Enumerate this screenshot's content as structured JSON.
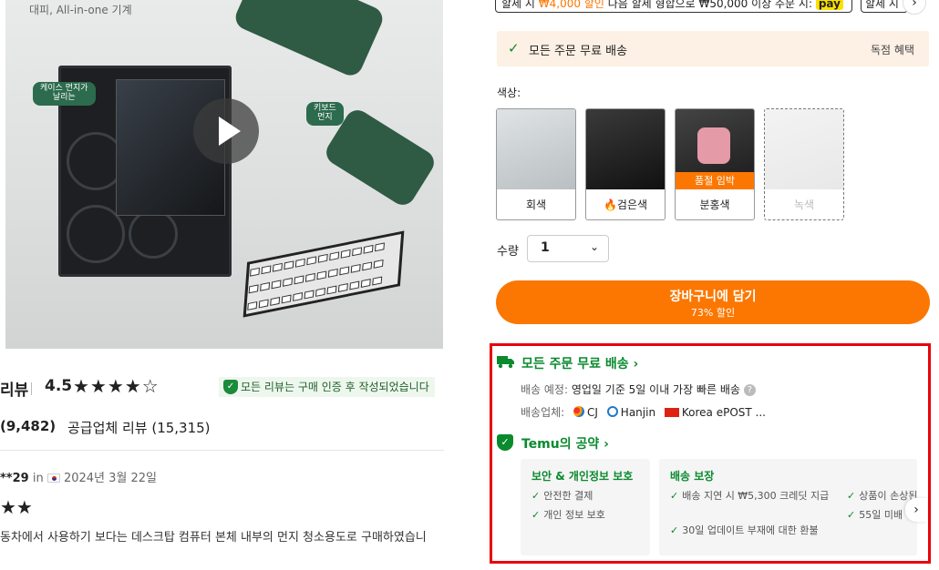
{
  "hero": {
    "caption": "대피, All-in-one 기계",
    "tag_case": "케이스 먼지가\n날리는",
    "tag_keyboard": "키보드\n먼지"
  },
  "reviews": {
    "title": "리뷰",
    "score": "4.5",
    "stars": "★★★★☆",
    "rating": 4.5,
    "verified_text": "모든 리뷰는 구매 인증 후 작성되었습니다",
    "count_product": "(9,482)",
    "count_supplier": "공급업체 리뷰 (15,315)",
    "first": {
      "user": "**29",
      "in": "in",
      "date": "2024년 3월 22일",
      "stars": "★★",
      "text": "동차에서 사용하기 보다는 데스크탑 컴퓨터 본체 내부의 먼지 청소용도로 구매하였습니"
    }
  },
  "promo": {
    "left_text_a": "할세 시 ",
    "left_price": "₩4,000 할인",
    "left_text_b": " 다음 할세 형합으로 ₩50,000 이상 주문 시: ",
    "pay": "pay",
    "right_text": "할세 시"
  },
  "free_shipping_banner": {
    "text": "모든 주문 무료 배송",
    "right": "독점 혜택"
  },
  "color": {
    "label": "색상:",
    "options": [
      {
        "label": "회색",
        "badge": ""
      },
      {
        "label": "검은색",
        "badge": ""
      },
      {
        "label": "분홍색",
        "badge": "품절 임박"
      },
      {
        "label": "녹색",
        "badge": ""
      }
    ]
  },
  "quantity": {
    "label": "수량",
    "value": "1"
  },
  "cart": {
    "label": "장바구니에 담기",
    "discount": "73% 할인"
  },
  "shipping": {
    "title": "모든 주문 무료 배송 ›",
    "eta_label": "배송 예정: ",
    "eta_value": "영업일 기준 5일 이내 가장 빠른 배송",
    "carriers_label": "배송업체:",
    "carriers": [
      "CJ",
      "Hanjin",
      "Korea ePOST ..."
    ]
  },
  "promise": {
    "title": "Temu의 공약 ›",
    "cards": [
      {
        "title": "보안 & 개인정보 보호",
        "items": [
          "안전한 결제",
          "개인 정보 보호"
        ]
      },
      {
        "title": "배송 보장",
        "items": [
          "배송 지연 시 ₩5,300 크레딧 지급",
          "30일 업데이트 부재에 대한 환불",
          "상품이 손상된",
          "55일 미배"
        ]
      }
    ]
  },
  "colors": {
    "accent": "#fb7701",
    "green": "#0a8a2e",
    "frame": "#e8000b"
  }
}
